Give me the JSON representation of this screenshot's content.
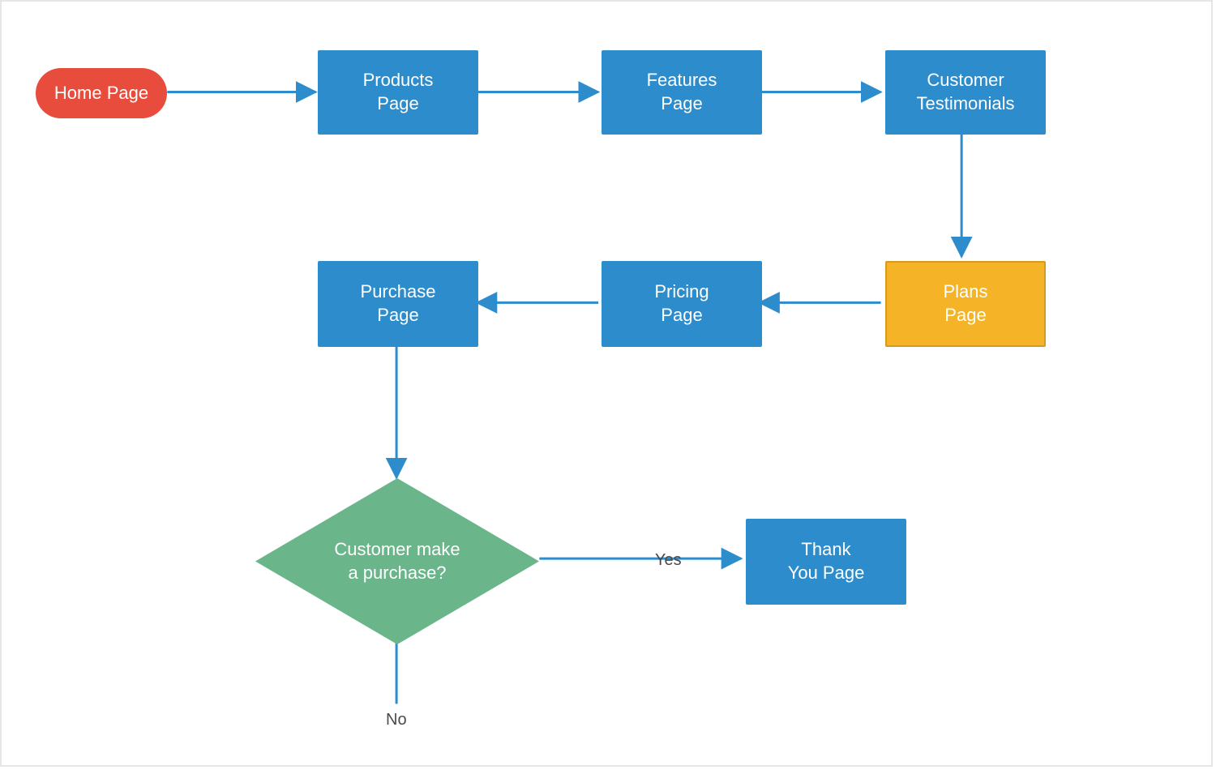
{
  "colors": {
    "red": "#e84c3d",
    "blue": "#2d8ccc",
    "green": "#6ab58a",
    "orange": "#f5b327",
    "orange_border": "#d59a1f",
    "arrow": "#2d8ccc",
    "edge_label": "#4a4a4a",
    "canvas_border": "#e6e6e6"
  },
  "nodes": {
    "home": {
      "label_line1": "Home Page",
      "label_line2": ""
    },
    "products": {
      "label_line1": "Products",
      "label_line2": "Page"
    },
    "features": {
      "label_line1": "Features",
      "label_line2": "Page"
    },
    "testimonials": {
      "label_line1": "Customer",
      "label_line2": "Testimonials"
    },
    "plans": {
      "label_line1": "Plans",
      "label_line2": "Page"
    },
    "pricing": {
      "label_line1": "Pricing",
      "label_line2": "Page"
    },
    "purchase": {
      "label_line1": "Purchase",
      "label_line2": "Page"
    },
    "decision": {
      "label_line1": "Customer make",
      "label_line2": "a purchase?"
    },
    "thankyou": {
      "label_line1": "Thank",
      "label_line2": "You  Page"
    }
  },
  "edge_labels": {
    "yes": "Yes",
    "no": "No"
  },
  "flow": [
    {
      "from": "home",
      "to": "products"
    },
    {
      "from": "products",
      "to": "features"
    },
    {
      "from": "features",
      "to": "testimonials"
    },
    {
      "from": "testimonials",
      "to": "plans"
    },
    {
      "from": "plans",
      "to": "pricing"
    },
    {
      "from": "pricing",
      "to": "purchase"
    },
    {
      "from": "purchase",
      "to": "decision"
    },
    {
      "from": "decision",
      "to": "thankyou",
      "label": "Yes"
    },
    {
      "from": "decision",
      "to": null,
      "label": "No"
    }
  ]
}
